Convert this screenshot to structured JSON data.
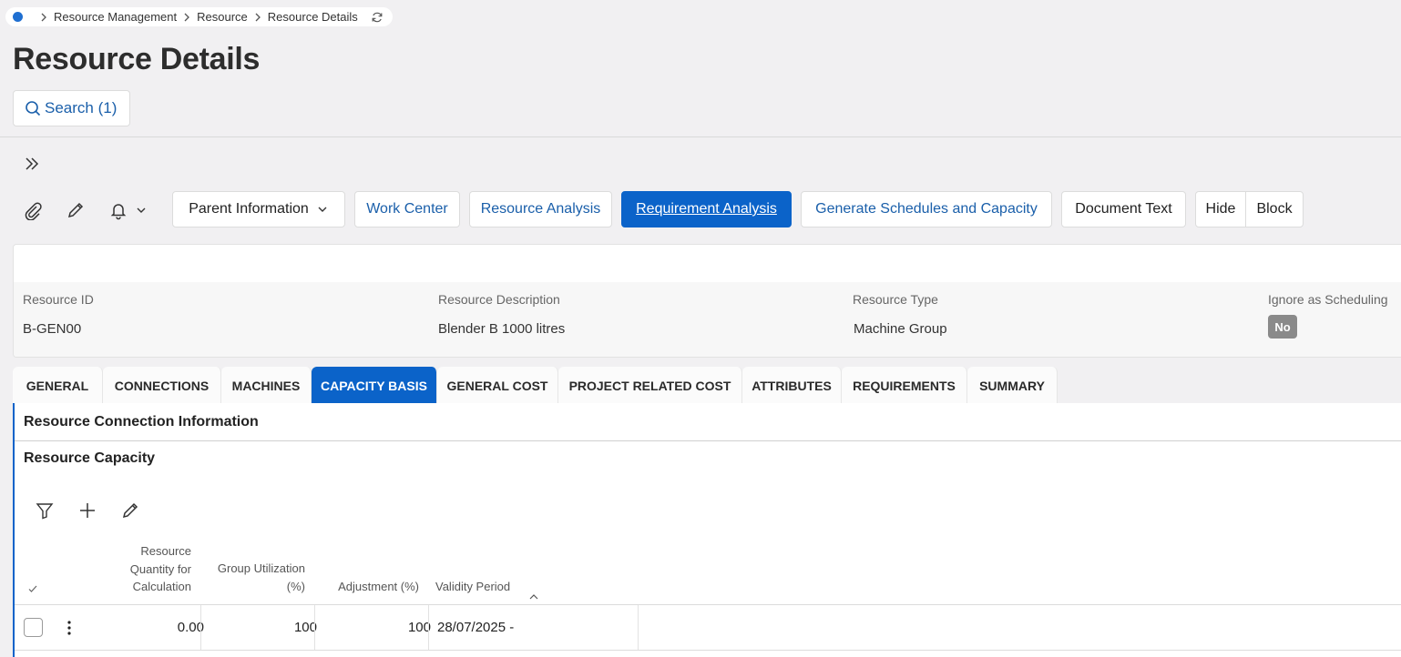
{
  "breadcrumb": {
    "items": [
      "Resource Management",
      "Resource",
      "Resource Details"
    ]
  },
  "page": {
    "title": "Resource Details"
  },
  "search": {
    "label": "Search (1)"
  },
  "toolbar": {
    "parent_info": "Parent Information",
    "work_center": "Work Center",
    "resource_analysis": "Resource Analysis",
    "requirement_analysis": "Requirement Analysis",
    "generate_schedules": "Generate Schedules and Capacity",
    "document_text": "Document Text",
    "hide": "Hide",
    "block": "Block"
  },
  "header": {
    "fields": [
      {
        "label": "Resource ID",
        "value": "B-GEN00"
      },
      {
        "label": "Resource Description",
        "value": "Blender B 1000 litres"
      },
      {
        "label": "Resource Type",
        "value": "Machine Group"
      },
      {
        "label": "Ignore as Scheduling",
        "value": "No"
      }
    ]
  },
  "tabs": [
    "GENERAL",
    "CONNECTIONS",
    "MACHINES",
    "CAPACITY BASIS",
    "GENERAL COST",
    "PROJECT RELATED COST",
    "ATTRIBUTES",
    "REQUIREMENTS",
    "SUMMARY"
  ],
  "active_tab": "CAPACITY BASIS",
  "sections": {
    "connection_info": "Resource Connection Information",
    "capacity": "Resource Capacity"
  },
  "table": {
    "columns": {
      "quantity": [
        "Resource",
        "Quantity for",
        "Calculation"
      ],
      "utilization": [
        "Group Utilization",
        "(%)"
      ],
      "adjustment": "Adjustment (%)",
      "validity": "Validity Period"
    },
    "rows": [
      {
        "quantity": "0.00",
        "utilization": "100",
        "adjustment": "100",
        "validity": "28/07/2025 -"
      }
    ]
  },
  "colors": {
    "accent": "#0b63c9",
    "link": "#1a5faa",
    "background": "#f1f0f2",
    "badge": "#8a8a8a"
  }
}
